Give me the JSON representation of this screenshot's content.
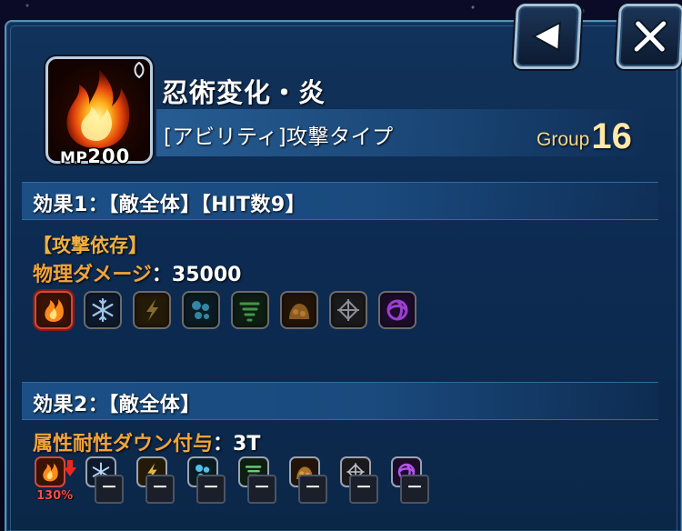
{
  "skill": {
    "name": "忍術変化・炎",
    "type": "[アビリティ]攻撃タイプ",
    "mp_label": "MP",
    "mp_value": "200",
    "group_label": "Group",
    "group_value": "16"
  },
  "effect1": {
    "header": "効果1：【敵全体】【HIT数9】",
    "dependency": "【攻撃依存】",
    "damage_label": "物理ダメージ",
    "damage_sep": "：",
    "damage_value": "35000",
    "attributes": [
      {
        "icon": "fire-icon",
        "active": true
      },
      {
        "icon": "ice-icon",
        "active": false
      },
      {
        "icon": "lightning-icon",
        "active": false
      },
      {
        "icon": "water-icon",
        "active": false
      },
      {
        "icon": "wind-icon",
        "active": false
      },
      {
        "icon": "earth-icon",
        "active": false
      },
      {
        "icon": "light-icon",
        "active": false
      },
      {
        "icon": "dark-icon",
        "active": false
      }
    ]
  },
  "effect2": {
    "header": "効果2：【敵全体】",
    "debuff_label": "属性耐性ダウン付与",
    "debuff_sep": "：",
    "debuff_value": "3T",
    "fire_resist_pct": "130%",
    "resist_placeholder": "－"
  },
  "colors": {
    "label_orange": "#f2a43a",
    "panel_blue": "#0d2b52",
    "header_blue": "#1b4f86",
    "group_gold": "#ffe9a8"
  },
  "icons": {
    "back": "back-arrow-icon",
    "close": "close-icon"
  }
}
